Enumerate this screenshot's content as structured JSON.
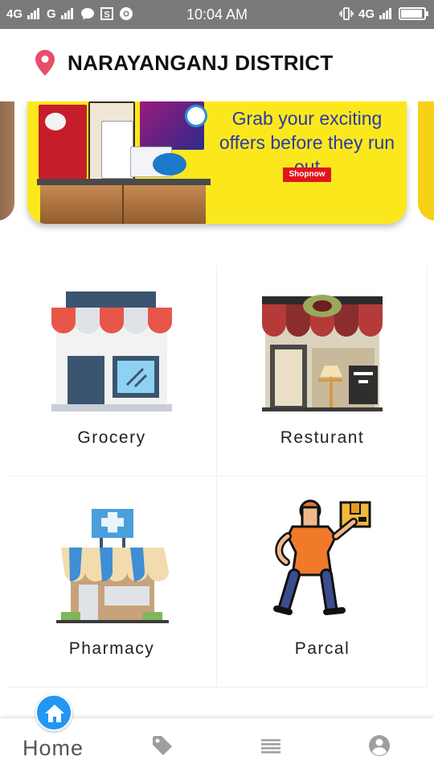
{
  "status_bar": {
    "network_left": "4G",
    "network_right_left": "G",
    "time": "10:04 AM",
    "network_right": "4G",
    "battery_level": 0.85
  },
  "location": {
    "title": "NARAYANGANJ DISTRICT",
    "pin_color": "#e84d6a"
  },
  "banner": {
    "text": "Grab your exciting offers before they run out",
    "button_label": "Shopnow",
    "background": "#fbe81c"
  },
  "categories": [
    {
      "label": "Grocery",
      "icon": "grocery-store-icon"
    },
    {
      "label": "Resturant",
      "icon": "restaurant-icon"
    },
    {
      "label": "Pharmacy",
      "icon": "pharmacy-icon"
    },
    {
      "label": "Parcal",
      "icon": "parcel-courier-icon"
    }
  ],
  "bottom_nav": {
    "home_label": "Home",
    "accent": "#2196f3",
    "items": [
      {
        "icon": "home-icon",
        "active": true
      },
      {
        "icon": "tag-icon",
        "active": false
      },
      {
        "icon": "list-icon",
        "active": false
      },
      {
        "icon": "account-icon",
        "active": false
      }
    ]
  }
}
